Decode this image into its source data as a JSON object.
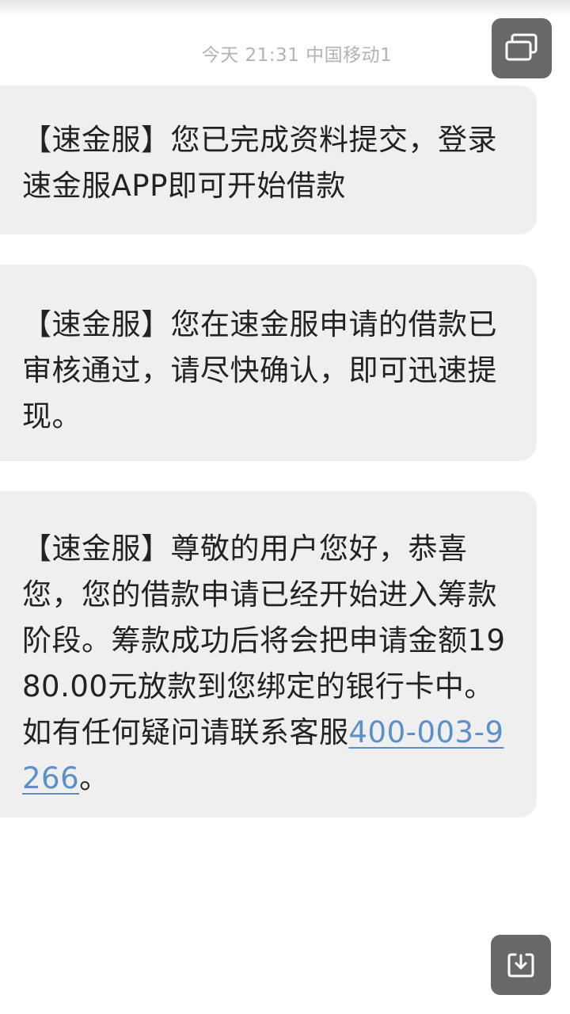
{
  "header": {
    "time": "今天 21:31",
    "carrier": "中国移动1"
  },
  "messages": [
    {
      "text": "【速金服】您已完成资料提交，登录速金服APP即可开始借款"
    },
    {
      "text": "【速金服】您在速金服申请的借款已审核通过，请尽快确认，即可迅速提现。"
    },
    {
      "text": "【速金服】尊敬的用户您好，恭喜您，您的借款申请已经开始进入筹款阶段。筹款成功后将会把申请金额1980.00元放款到您绑定的银行卡中。如有任何疑问请联系客服",
      "phone": "400-003-9266",
      "tail": "。"
    }
  ],
  "controls": {
    "top_icon": "multi-window-icon",
    "bottom_icon": "download-icon"
  },
  "colors": {
    "bubble": "#efefef",
    "link": "#5b8fc9",
    "floating_button": "#5c5c5c"
  }
}
